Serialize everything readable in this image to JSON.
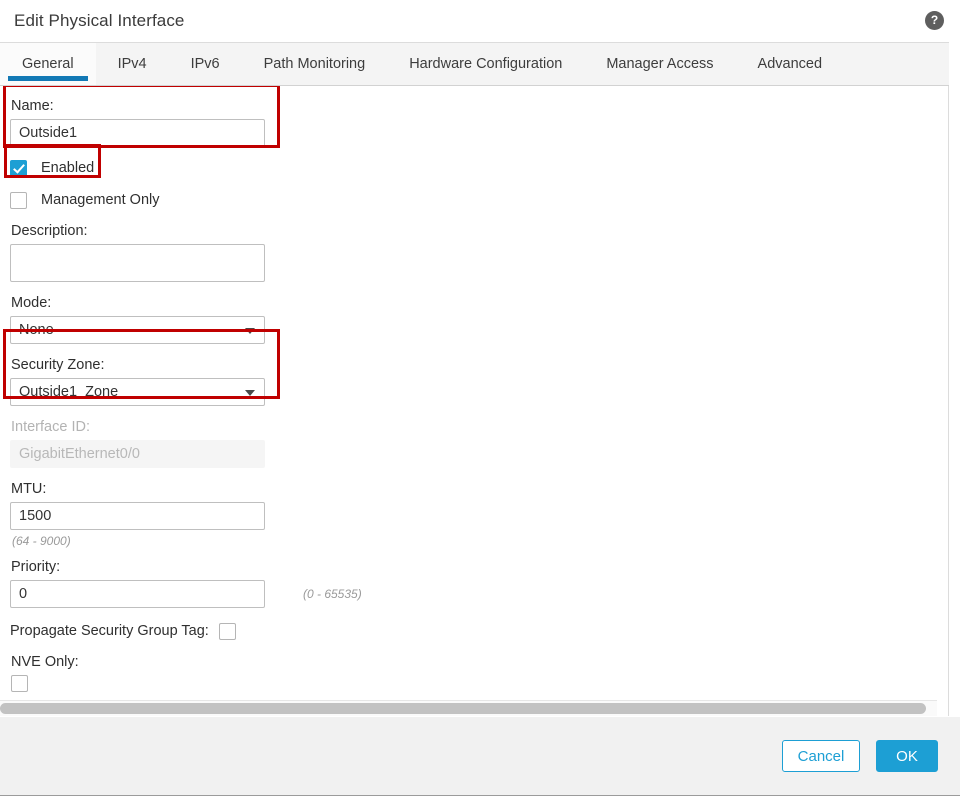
{
  "dialog": {
    "title": "Edit Physical Interface",
    "help_icon": "question-mark-icon",
    "help_glyph": "?"
  },
  "tabs": [
    {
      "label": "General",
      "active": true
    },
    {
      "label": "IPv4",
      "active": false
    },
    {
      "label": "IPv6",
      "active": false
    },
    {
      "label": "Path Monitoring",
      "active": false
    },
    {
      "label": "Hardware Configuration",
      "active": false
    },
    {
      "label": "Manager Access",
      "active": false
    },
    {
      "label": "Advanced",
      "active": false
    }
  ],
  "form": {
    "name": {
      "label": "Name:",
      "value": "Outside1",
      "placeholder": ""
    },
    "enabled": {
      "label": "Enabled",
      "checked": true
    },
    "management_only": {
      "label": "Management Only",
      "checked": false
    },
    "description": {
      "label": "Description:",
      "value": "",
      "placeholder": ""
    },
    "mode": {
      "label": "Mode:",
      "value": "None",
      "options": [
        "None"
      ]
    },
    "security_zone": {
      "label": "Security Zone:",
      "value": "Outside1_Zone",
      "options": [
        "Outside1_Zone"
      ]
    },
    "interface_id": {
      "label": "Interface ID:",
      "value": "GigabitEthernet0/0",
      "disabled": true
    },
    "mtu": {
      "label": "MTU:",
      "value": "1500",
      "hint": "(64 - 9000)"
    },
    "priority": {
      "label": "Priority:",
      "value": "0",
      "hint": "(0 - 65535)"
    },
    "propagate_sgt": {
      "label": "Propagate Security Group Tag:",
      "checked": false
    },
    "nve_only": {
      "label": "NVE Only:",
      "checked": false
    }
  },
  "footer": {
    "cancel_label": "Cancel",
    "ok_label": "OK"
  },
  "colors": {
    "accent_blue": "#1d9fd4",
    "tab_underline": "#1379b5",
    "annotation_red": "#c00000",
    "footer_bg": "#f1f1f1"
  }
}
